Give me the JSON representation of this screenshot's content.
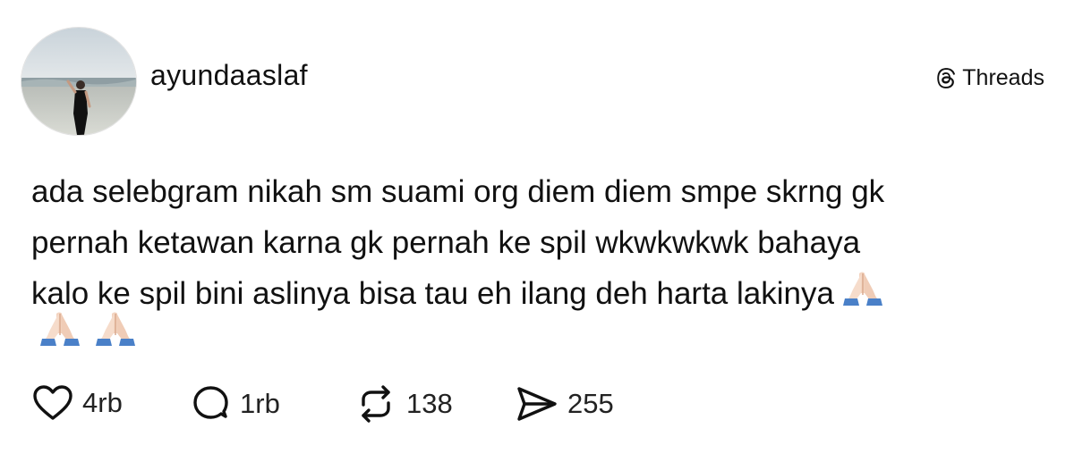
{
  "post": {
    "username": "ayundaaslaf",
    "brand": {
      "label": "Threads",
      "icon": "threads-logo-icon"
    },
    "text_lines": [
      "ada selebgram nikah sm suami org diem diem smpe skrng gk",
      "pernah ketawan karna gk pernah ke spil wkwkwkwk bahaya",
      "kalo ke spil bini aslinya bisa tau eh ilang deh harta lakinya"
    ],
    "emoji": {
      "name": "folded-hands-emoji",
      "count_total": 3
    },
    "actions": {
      "like": {
        "icon": "heart-icon",
        "count": "4rb"
      },
      "reply": {
        "icon": "comment-bubble-icon",
        "count": "1rb"
      },
      "repost": {
        "icon": "repost-icon",
        "count": "138"
      },
      "share": {
        "icon": "send-icon",
        "count": "255"
      }
    }
  },
  "colors": {
    "text": "#111111",
    "emoji_skin": "#f3d4c0",
    "emoji_sleeve": "#4a80c8"
  }
}
